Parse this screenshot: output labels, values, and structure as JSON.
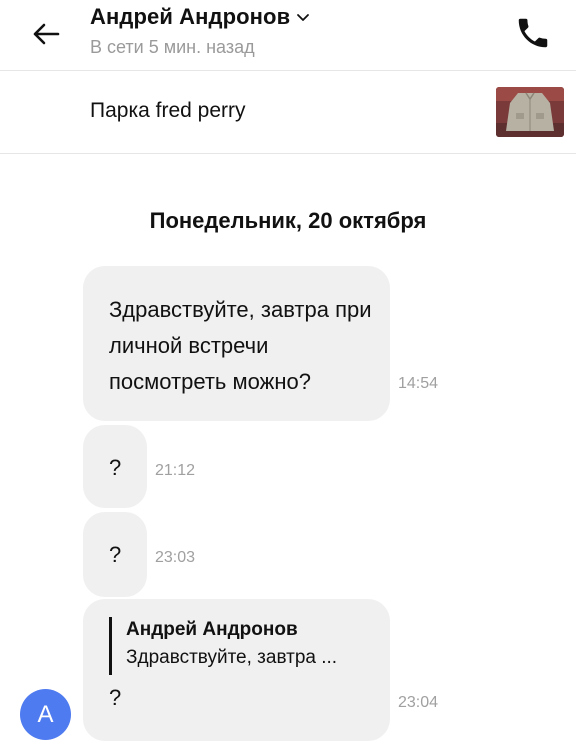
{
  "header": {
    "contact_name": "Андрей Андронов",
    "status": "В сети 5 мин. назад"
  },
  "item": {
    "title": "Парка fred perry"
  },
  "chat": {
    "date_divider": "Понедельник, 20 октября",
    "messages": [
      {
        "text": "Здравствуйте, завтра при личной встречи посмотреть можно?",
        "time": "14:54"
      },
      {
        "text": "?",
        "time": "21:12"
      },
      {
        "text": "?",
        "time": "23:03"
      },
      {
        "quote_author": "Андрей Андронов",
        "quote_text": "Здравствуйте, завтра ...",
        "text": "?",
        "time": "23:04"
      }
    ]
  },
  "avatar": {
    "initial": "А",
    "color": "#4f7bf0"
  },
  "icons": [
    "back-arrow-icon",
    "chevron-down-icon",
    "phone-icon"
  ]
}
